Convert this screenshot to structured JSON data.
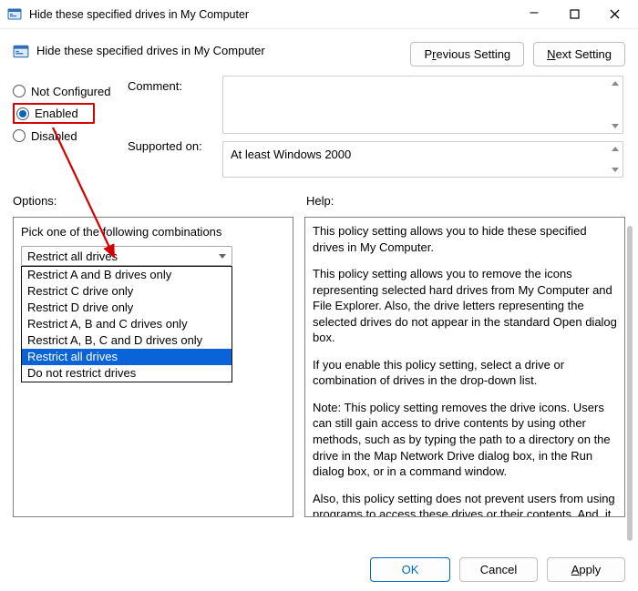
{
  "window": {
    "title": "Hide these specified drives in My Computer"
  },
  "header": {
    "title": "Hide these specified drives in My Computer",
    "prev_pre": "P",
    "prev_u": "r",
    "prev_post": "evious Setting",
    "next_pre": "",
    "next_u": "N",
    "next_post": "ext Setting"
  },
  "radios": {
    "not_configured": "Not Configured",
    "enabled": "Enabled",
    "disabled": "Disabled",
    "not_configured_u": "C",
    "enabled_u": "E",
    "disabled_u": "D"
  },
  "labels": {
    "comment": "Comment:",
    "supported": "Supported on:",
    "options": "Options:",
    "help": "Help:"
  },
  "supported_text": "At least Windows 2000",
  "options": {
    "pick_label": "Pick one of the following combinations",
    "selected": "Restrict all drives",
    "items": [
      "Restrict A and B drives only",
      "Restrict C drive only",
      "Restrict D drive only",
      "Restrict A, B and C drives only",
      "Restrict A, B, C and D drives only",
      "Restrict all drives",
      "Do not restrict drives"
    ],
    "selected_index": 5
  },
  "help": {
    "p1": "This policy setting allows you to hide these specified drives in My Computer.",
    "p2": "This policy setting allows you to remove the icons representing selected hard drives from My Computer and File Explorer. Also, the drive letters representing the selected drives do not appear in the standard Open dialog box.",
    "p3": "If you enable this policy setting, select a drive or combination of drives in the drop-down list.",
    "p4": "Note: This policy setting removes the drive icons. Users can still gain access to drive contents by using other methods, such as by typing the path to a directory on the drive in the Map Network Drive dialog box, in the Run dialog box, or in a command window.",
    "p5": "Also, this policy setting does not prevent users from using programs to access these drives or their contents. And, it does not prevent users from using the Disk Management snap-in to view and change drive characteristics."
  },
  "footer": {
    "ok": "OK",
    "cancel": "Cancel",
    "apply_pre": "",
    "apply_u": "A",
    "apply_post": "pply"
  }
}
